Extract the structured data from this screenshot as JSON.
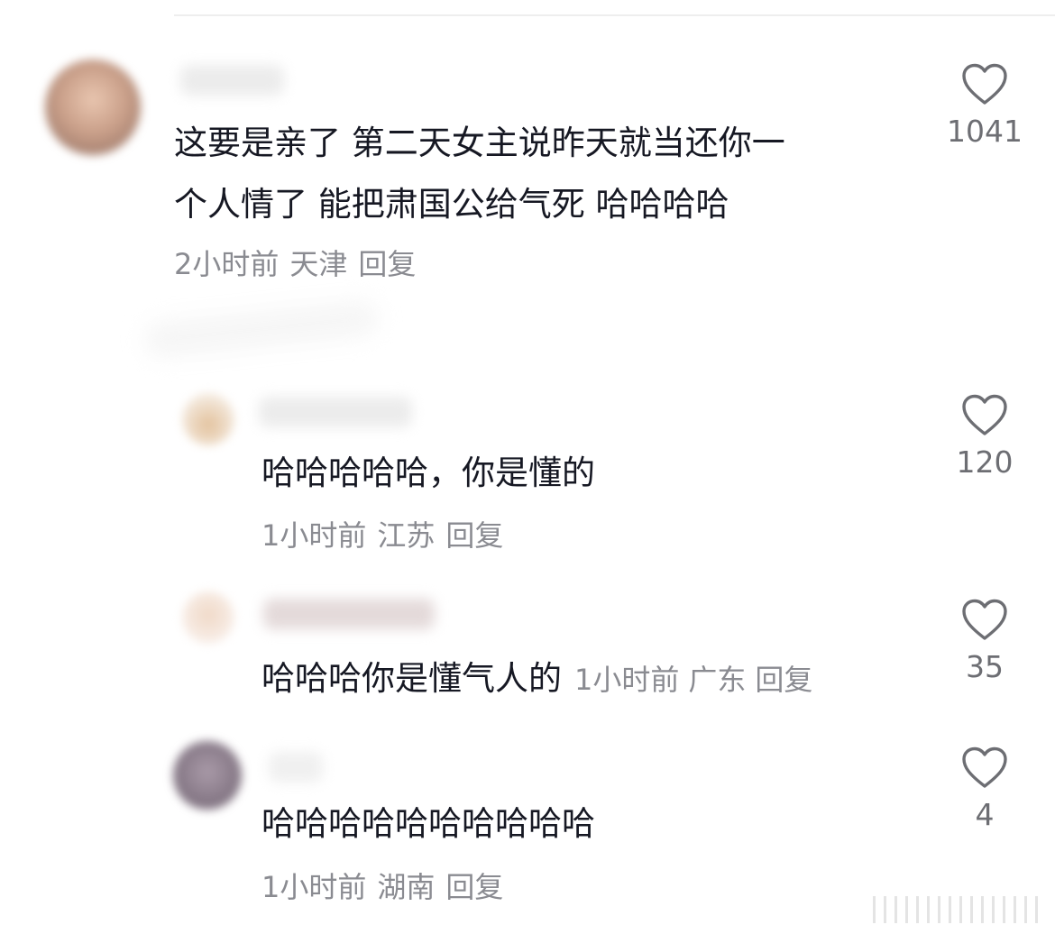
{
  "comments": [
    {
      "text_lines": [
        "这要是亲了 第二天女主说昨天就当还你一",
        "个人情了 能把肃国公给气死 哈哈哈哈"
      ],
      "time": "2小时前",
      "location": "天津",
      "reply_label": "回复",
      "likes": "1041"
    }
  ],
  "replies": [
    {
      "text": "哈哈哈哈哈，你是懂的",
      "time": "1小时前",
      "location": "江苏",
      "reply_label": "回复",
      "likes": "120"
    },
    {
      "text": "哈哈哈你是懂气人的",
      "time": "1小时前",
      "location": "广东",
      "reply_label": "回复",
      "likes": "35"
    },
    {
      "text": "哈哈哈哈哈哈哈哈哈哈",
      "time": "1小时前",
      "location": "湖南",
      "reply_label": "回复",
      "likes": "4"
    }
  ],
  "icons": {
    "like": "heart-outline-icon"
  }
}
